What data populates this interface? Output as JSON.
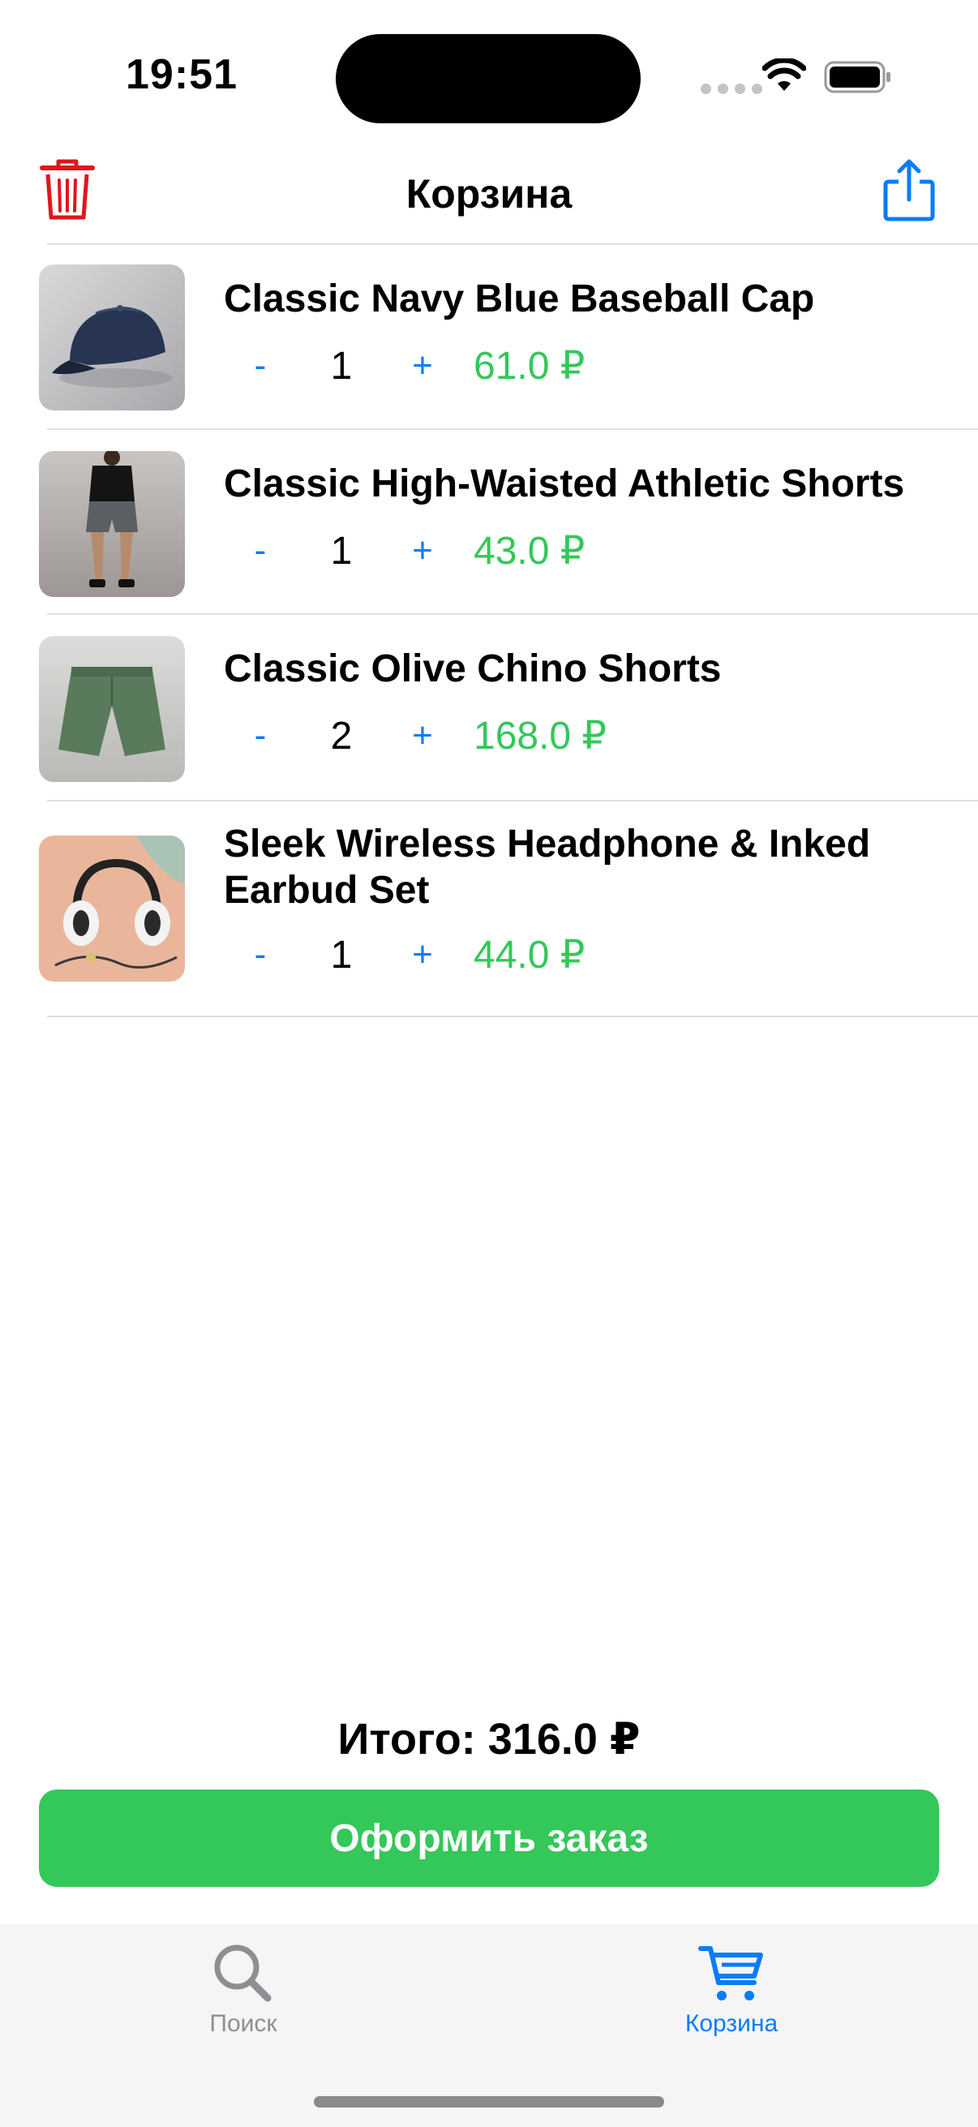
{
  "status_bar": {
    "time": "19:51"
  },
  "nav": {
    "title": "Корзина",
    "left_icon": "trash-icon",
    "right_icon": "share-icon",
    "accent_delete": "#e0161c",
    "accent_share": "#0a7cf7"
  },
  "cart": {
    "items": [
      {
        "title": "Classic Navy Blue Baseball Cap",
        "qty_minus": "-",
        "quantity": "1",
        "qty_plus": "+",
        "price": "61.0 ₽"
      },
      {
        "title": "Classic High-Waisted Athletic Shorts",
        "qty_minus": "-",
        "quantity": "1",
        "qty_plus": "+",
        "price": "43.0 ₽"
      },
      {
        "title": "Classic Olive Chino Shorts",
        "qty_minus": "-",
        "quantity": "2",
        "qty_plus": "+",
        "price": "168.0 ₽"
      },
      {
        "title": "Sleek Wireless Headphone & Inked Earbud Set",
        "qty_minus": "-",
        "quantity": "1",
        "qty_plus": "+",
        "price": "44.0 ₽"
      }
    ]
  },
  "summary": {
    "total": "Итого: 316.0 ₽",
    "checkout_label": "Оформить заказ",
    "checkout_color": "#34c759"
  },
  "tab_bar": {
    "tabs": [
      {
        "label": "Поиск",
        "icon": "magnifying-glass-icon",
        "selected": false
      },
      {
        "label": "Корзина",
        "icon": "cart-icon",
        "selected": true
      }
    ],
    "selected_color": "#0a7cf7",
    "unselected_color": "#8e8e93"
  }
}
